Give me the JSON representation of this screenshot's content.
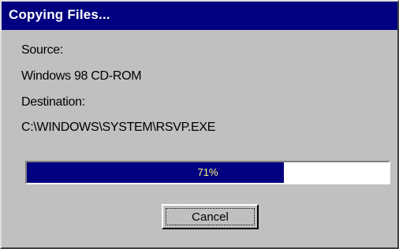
{
  "window": {
    "title": "Copying Files..."
  },
  "source": {
    "label": "Source:",
    "value": "Windows 98 CD-ROM"
  },
  "destination": {
    "label": "Destination:",
    "value": "C:\\WINDOWS\\SYSTEM\\RSVP.EXE"
  },
  "progress": {
    "percent": 71,
    "label": "71%"
  },
  "buttons": {
    "cancel_label": "Cancel"
  },
  "colors": {
    "titlebar": "#000080",
    "progress_fill": "#000080",
    "dialog_face": "#c0c0c0"
  }
}
